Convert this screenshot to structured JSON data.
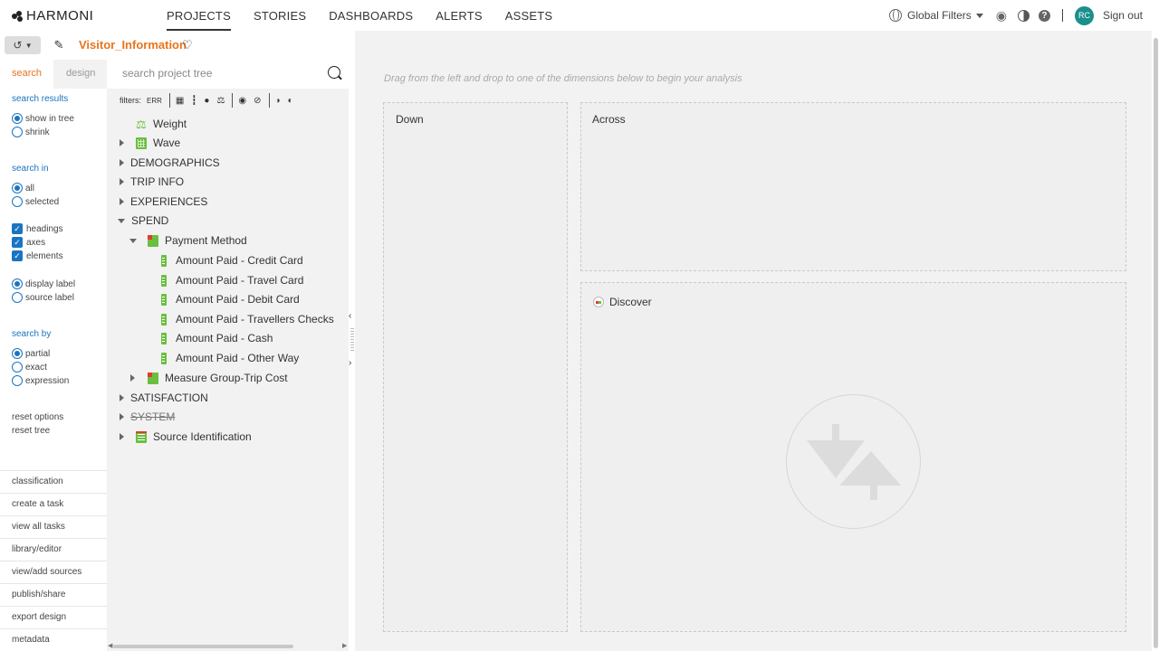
{
  "app": {
    "logo": "HARMONI"
  },
  "nav": {
    "items": [
      "PROJECTS",
      "STORIES",
      "DASHBOARDS",
      "ALERTS",
      "ASSETS"
    ],
    "active": "PROJECTS"
  },
  "tools": {
    "global_filters": "Global Filters",
    "avatar": "RC",
    "sign_out": "Sign out",
    "help": "?"
  },
  "project": {
    "name": "Visitor_Information"
  },
  "options": {
    "tabs": {
      "search": "search",
      "design": "design"
    },
    "search_results": {
      "heading": "search results",
      "show_in_tree": "show in tree",
      "shrink": "shrink"
    },
    "search_in": {
      "heading": "search in",
      "all": "all",
      "selected": "selected"
    },
    "checks": {
      "headings": "headings",
      "axes": "axes",
      "elements": "elements"
    },
    "labels": {
      "display": "display label",
      "source": "source label"
    },
    "search_by": {
      "heading": "search by",
      "partial": "partial",
      "exact": "exact",
      "expression": "expression"
    },
    "reset_options": "reset options",
    "reset_tree": "reset tree",
    "bottom_links": [
      "classification",
      "create a task",
      "view all tasks",
      "library/editor",
      "view/add sources",
      "publish/share",
      "export design",
      "metadata"
    ]
  },
  "tree": {
    "search_placeholder": "search project tree",
    "filters_label": "filters:",
    "err_label": "ERR",
    "rows": {
      "weight": "Weight",
      "wave": "Wave",
      "demographics": "DEMOGRAPHICS",
      "trip_info": "TRIP INFO",
      "experiences": "EXPERIENCES",
      "spend": "SPEND",
      "payment_method": "Payment Method",
      "credit": "Amount Paid - Credit Card",
      "travel": "Amount Paid - Travel Card",
      "debit": "Amount Paid - Debit Card",
      "checks": "Amount Paid - Travellers Checks",
      "cash": "Amount Paid - Cash",
      "other": "Amount Paid - Other Way",
      "trip_cost": "Measure Group-Trip Cost",
      "satisfaction": "SATISFACTION",
      "system": "SYSTEM",
      "source_id": "Source Identification"
    }
  },
  "main": {
    "hint": "Drag from the left and drop to one of the dimensions below to begin your analysis",
    "down": "Down",
    "across": "Across",
    "discover": "Discover"
  }
}
